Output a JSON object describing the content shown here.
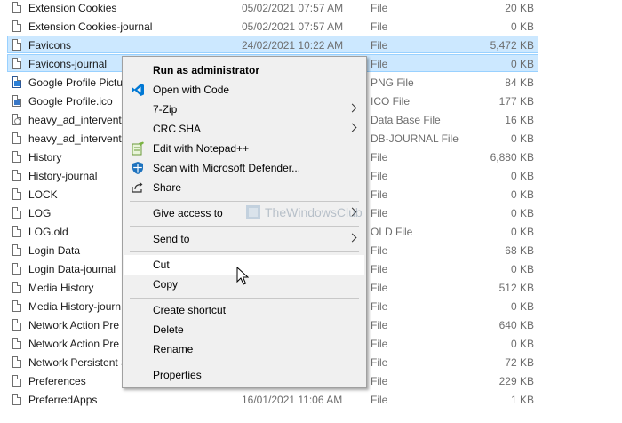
{
  "files": [
    {
      "name": "Extension Cookies",
      "date": "05/02/2021 07:57 AM",
      "type": "File",
      "size": "20 KB",
      "icon": "file-icon"
    },
    {
      "name": "Extension Cookies-journal",
      "date": "05/02/2021 07:57 AM",
      "type": "File",
      "size": "0 KB",
      "icon": "file-icon"
    },
    {
      "name": "Favicons",
      "date": "24/02/2021 10:22 AM",
      "type": "File",
      "size": "5,472 KB",
      "icon": "file-icon",
      "selected": true
    },
    {
      "name": "Favicons-journal",
      "date": "",
      "type": "File",
      "size": "0 KB",
      "icon": "file-icon",
      "selected": true
    },
    {
      "name": "Google Profile Pictu",
      "date": "",
      "type": "PNG File",
      "size": "84 KB",
      "icon": "png-file-icon"
    },
    {
      "name": "Google Profile.ico",
      "date": "",
      "type": "ICO File",
      "size": "177 KB",
      "icon": "ico-file-icon"
    },
    {
      "name": "heavy_ad_interventi",
      "date": "",
      "type": "Data Base File",
      "size": "16 KB",
      "icon": "database-file-icon"
    },
    {
      "name": "heavy_ad_interventi",
      "date": "",
      "type": "DB-JOURNAL File",
      "size": "0 KB",
      "icon": "file-icon"
    },
    {
      "name": "History",
      "date": "",
      "type": "File",
      "size": "6,880 KB",
      "icon": "file-icon"
    },
    {
      "name": "History-journal",
      "date": "",
      "type": "File",
      "size": "0 KB",
      "icon": "file-icon"
    },
    {
      "name": "LOCK",
      "date": "",
      "type": "File",
      "size": "0 KB",
      "icon": "file-icon"
    },
    {
      "name": "LOG",
      "date": "",
      "type": "File",
      "size": "0 KB",
      "icon": "file-icon"
    },
    {
      "name": "LOG.old",
      "date": "",
      "type": "OLD File",
      "size": "0 KB",
      "icon": "file-icon"
    },
    {
      "name": "Login Data",
      "date": "",
      "type": "File",
      "size": "68 KB",
      "icon": "file-icon"
    },
    {
      "name": "Login Data-journal",
      "date": "",
      "type": "File",
      "size": "0 KB",
      "icon": "file-icon"
    },
    {
      "name": "Media History",
      "date": "",
      "type": "File",
      "size": "512 KB",
      "icon": "file-icon"
    },
    {
      "name": "Media History-journ",
      "date": "",
      "type": "File",
      "size": "0 KB",
      "icon": "file-icon"
    },
    {
      "name": "Network Action Pre",
      "date": "",
      "type": "File",
      "size": "640 KB",
      "icon": "file-icon"
    },
    {
      "name": "Network Action Pre",
      "date": "",
      "type": "File",
      "size": "0 KB",
      "icon": "file-icon"
    },
    {
      "name": "Network Persistent S",
      "date": "",
      "type": "File",
      "size": "72 KB",
      "icon": "file-icon"
    },
    {
      "name": "Preferences",
      "date": "",
      "type": "File",
      "size": "229 KB",
      "icon": "file-icon"
    },
    {
      "name": "PreferredApps",
      "date": "16/01/2021 11:06 AM",
      "type": "File",
      "size": "1 KB",
      "icon": "file-icon"
    }
  ],
  "context_menu": {
    "run_as_admin": "Run as administrator",
    "open_with_code": "Open with Code",
    "seven_zip": "7-Zip",
    "crc_sha": "CRC SHA",
    "edit_notepad": "Edit with Notepad++",
    "scan_defender": "Scan with Microsoft Defender...",
    "share": "Share",
    "give_access": "Give access to",
    "send_to": "Send to",
    "cut": "Cut",
    "copy": "Copy",
    "create_shortcut": "Create shortcut",
    "delete": "Delete",
    "rename": "Rename",
    "properties": "Properties"
  },
  "watermark": {
    "text": "TheWindowsClub"
  },
  "colors": {
    "selection": "#cce8ff",
    "selection_border": "#99d1ff",
    "menu_bg": "#f0f0f0",
    "vscode_blue": "#0078d4"
  }
}
